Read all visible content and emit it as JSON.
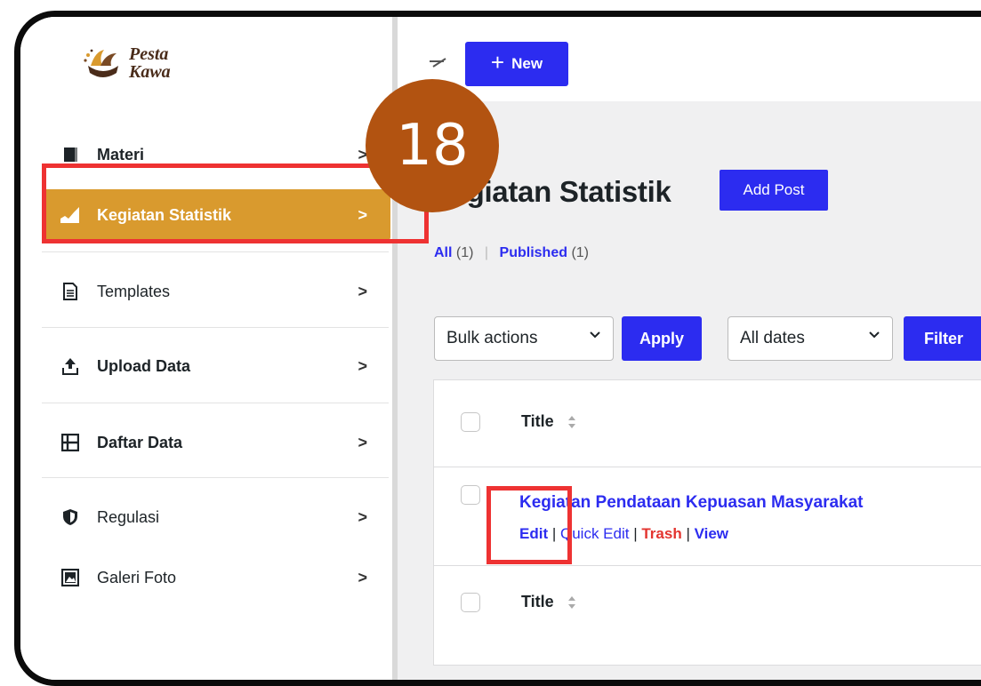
{
  "brand": {
    "line1": "Pesta",
    "line2": "Kawa"
  },
  "topbar": {
    "new_label": "New"
  },
  "sidebar": {
    "items": [
      {
        "label": "Materi",
        "icon": "book-icon"
      },
      {
        "label": "Kegiatan Statistik",
        "icon": "chart-icon",
        "active": true
      },
      {
        "label": "Templates",
        "icon": "document-icon"
      },
      {
        "label": "Upload Data",
        "icon": "upload-icon"
      },
      {
        "label": "Daftar Data",
        "icon": "table-icon"
      },
      {
        "label": "Regulasi",
        "icon": "shield-icon"
      },
      {
        "label": "Galeri Foto",
        "icon": "photo-icon"
      }
    ],
    "chevron": ">"
  },
  "page": {
    "title": "Kegiatan Statistik",
    "add_post": "Add Post",
    "filters": {
      "all_label": "All",
      "all_count": "(1)",
      "published_label": "Published",
      "published_count": "(1)"
    },
    "bulk_actions": "Bulk actions",
    "apply": "Apply",
    "all_dates": "All dates",
    "filter": "Filter"
  },
  "table": {
    "header_title": "Title",
    "footer_title": "Title",
    "rows": [
      {
        "title": "Kegiatan Pendataan Kepuasan Masyarakat",
        "actions": {
          "edit": "Edit",
          "quick_edit": "Quick Edit",
          "trash": "Trash",
          "view": "View"
        }
      }
    ]
  },
  "annotation": {
    "step": "18",
    "highlight_color": "#ee3232",
    "badge_color": "#b25311"
  },
  "colors": {
    "accent": "#2c2cf0",
    "active_menu": "#d99a2e",
    "trash": "#e3342f"
  }
}
